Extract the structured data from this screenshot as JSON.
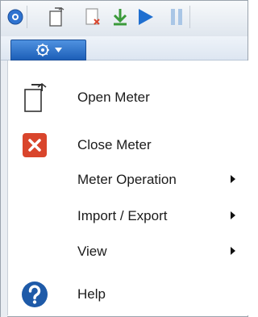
{
  "colors": {
    "accent": "#1d5fb8",
    "close_red": "#d9452c",
    "help_blue": "#1e5aa8",
    "play_blue": "#1f6fd0",
    "import_green": "#3a9a3a"
  },
  "toolbar": {
    "icons": [
      "app-logo-icon",
      "open-file-icon",
      "close-file-icon",
      "import-download-icon",
      "play-icon",
      "pause-icon"
    ]
  },
  "app_button": {
    "icon": "gear-icon",
    "dropdown": "chevron-down-icon"
  },
  "menu": {
    "items": [
      {
        "label": "Open Meter",
        "icon": "open-meter-icon",
        "submenu": false
      },
      {
        "label": "Close Meter",
        "icon": "close-meter-icon",
        "submenu": false
      },
      {
        "label": "Meter Operation",
        "icon": "",
        "submenu": true
      },
      {
        "label": "Import / Export",
        "icon": "",
        "submenu": true
      },
      {
        "label": "View",
        "icon": "",
        "submenu": true
      },
      {
        "label": "Help",
        "icon": "help-icon",
        "submenu": false
      }
    ]
  }
}
